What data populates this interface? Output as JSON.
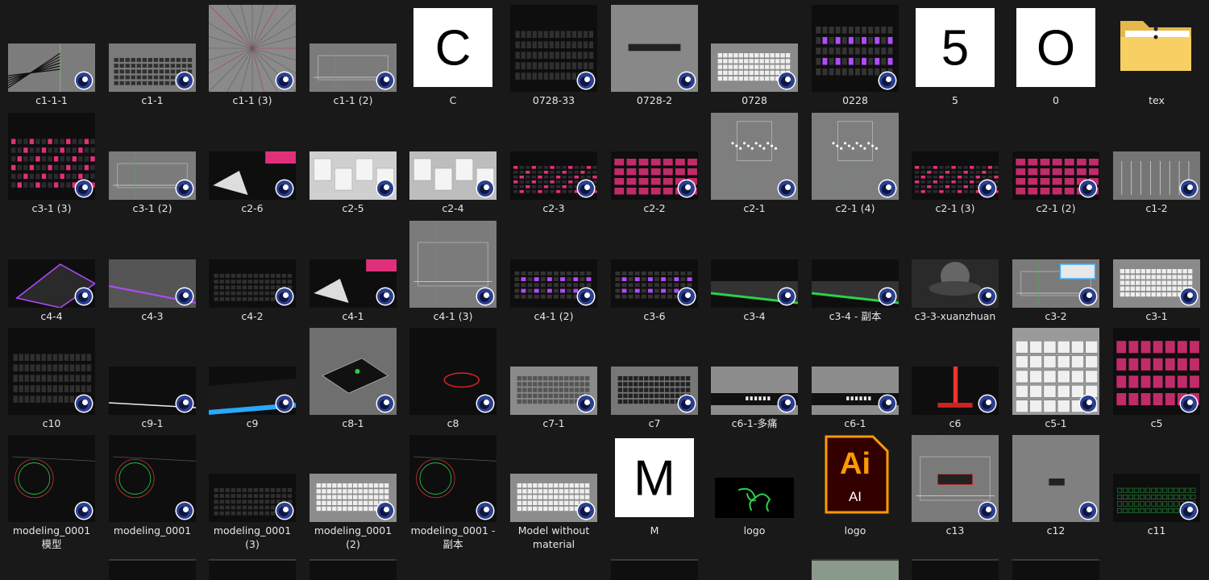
{
  "folder": {
    "items": [
      {
        "label": "c1-1-1",
        "type": "render",
        "style": "grey_lines"
      },
      {
        "label": "c1-1",
        "type": "render",
        "style": "grey"
      },
      {
        "label": "c1-1 (3)",
        "type": "render",
        "style": "rays",
        "tall": true
      },
      {
        "label": "c1-1 (2)",
        "type": "render",
        "style": "grey_wire"
      },
      {
        "label": "C",
        "type": "letter",
        "glyph": "C"
      },
      {
        "label": "0728-33",
        "type": "render",
        "style": "dark_keyboard",
        "tall": true
      },
      {
        "label": "0728-2",
        "type": "render",
        "style": "narrow_grey",
        "tall": true
      },
      {
        "label": "0728",
        "type": "render",
        "style": "white_keyboard"
      },
      {
        "label": "0228",
        "type": "render",
        "style": "purple_dots",
        "tall": true
      },
      {
        "label": "5",
        "type": "letter",
        "glyph": "5"
      },
      {
        "label": "0",
        "type": "letter",
        "glyph": "O"
      },
      {
        "label": "tex",
        "type": "folder"
      },
      {
        "label": "c3-1 (3)",
        "type": "render",
        "style": "dark_pink_grid",
        "tall": true
      },
      {
        "label": "c3-1 (2)",
        "type": "render",
        "style": "grey_wire"
      },
      {
        "label": "c2-6",
        "type": "render",
        "style": "dark_pink_light"
      },
      {
        "label": "c2-5",
        "type": "render",
        "style": "white_room"
      },
      {
        "label": "c2-4",
        "type": "render",
        "style": "white_keys"
      },
      {
        "label": "c2-3",
        "type": "render",
        "style": "dark_pink_grid"
      },
      {
        "label": "c2-2",
        "type": "render",
        "style": "pink_keys"
      },
      {
        "label": "c2-1",
        "type": "render",
        "style": "grey_dots",
        "tall": true
      },
      {
        "label": "c2-1 (4)",
        "type": "render",
        "style": "grey_dots",
        "tall": true
      },
      {
        "label": "c2-1 (3)",
        "type": "render",
        "style": "dark_pattern"
      },
      {
        "label": "c2-1 (2)",
        "type": "render",
        "style": "pink_keys"
      },
      {
        "label": "c1-2",
        "type": "render",
        "style": "grey_pillars"
      },
      {
        "label": "c4-4",
        "type": "render",
        "style": "dark_purple_edge"
      },
      {
        "label": "c4-3",
        "type": "render",
        "style": "grey_purple_strip"
      },
      {
        "label": "c4-2",
        "type": "render",
        "style": "dark_keyboard"
      },
      {
        "label": "c4-1",
        "type": "render",
        "style": "dark_pink_light"
      },
      {
        "label": "c4-1 (3)",
        "type": "render",
        "style": "grey_wire",
        "tall": true
      },
      {
        "label": "c4-1 (2)",
        "type": "render",
        "style": "purple_keyboard"
      },
      {
        "label": "c3-6",
        "type": "render",
        "style": "purple_keyboard"
      },
      {
        "label": "c3-4",
        "type": "render",
        "style": "green_glow"
      },
      {
        "label": "c3-4 - 副本",
        "type": "render",
        "style": "green_glow"
      },
      {
        "label": "c3-3-xuanzhuan",
        "type": "render",
        "style": "knob"
      },
      {
        "label": "c3-2",
        "type": "render",
        "style": "grey_wire_blue"
      },
      {
        "label": "c3-1",
        "type": "render",
        "style": "white_keyboard"
      },
      {
        "label": "c10",
        "type": "render",
        "style": "dark_grey",
        "tall": true
      },
      {
        "label": "c9-1",
        "type": "render",
        "style": "dark_white_strip"
      },
      {
        "label": "c9",
        "type": "render",
        "style": "blue_keyboard"
      },
      {
        "label": "c8-1",
        "type": "render",
        "style": "grey_box",
        "tall": true
      },
      {
        "label": "c8",
        "type": "render",
        "style": "dark_red_ring",
        "tall": true
      },
      {
        "label": "c7-1",
        "type": "render",
        "style": "grey_flat_keyboard"
      },
      {
        "label": "c7",
        "type": "render",
        "style": "grey_side_keyboard"
      },
      {
        "label": "c6-1-多痛",
        "type": "render",
        "style": "white_strip"
      },
      {
        "label": "c6-1",
        "type": "render",
        "style": "white_strip"
      },
      {
        "label": "c6",
        "type": "render",
        "style": "dark_red_beam"
      },
      {
        "label": "c5-1",
        "type": "render",
        "style": "white_keys_grid",
        "tall": true
      },
      {
        "label": "c5",
        "type": "render",
        "style": "pink_keys",
        "tall": true
      },
      {
        "label": "modeling_0001\n模型",
        "type": "render",
        "style": "modeling",
        "tall": true
      },
      {
        "label": "modeling_0001",
        "type": "render",
        "style": "modeling",
        "tall": true
      },
      {
        "label": "modeling_0001\n(3)",
        "type": "render",
        "style": "dark_keyboard"
      },
      {
        "label": "modeling_0001\n(2)",
        "type": "render",
        "style": "grey_white_keys"
      },
      {
        "label": "modeling_0001 -\n副本",
        "type": "render",
        "style": "modeling",
        "tall": true
      },
      {
        "label": "Model without\nmaterial",
        "type": "render",
        "style": "grey_white_keys"
      },
      {
        "label": "M",
        "type": "letter",
        "glyph": "M"
      },
      {
        "label": "logo",
        "type": "razer"
      },
      {
        "label": "logo",
        "type": "ai",
        "glyph_top": "Ai",
        "glyph_bottom": "AI"
      },
      {
        "label": "c13",
        "type": "render",
        "style": "grey_wire_red",
        "tall": true
      },
      {
        "label": "c12",
        "type": "render",
        "style": "grey_plain",
        "tall": true
      },
      {
        "label": "c11",
        "type": "render",
        "style": "green_keyboard"
      }
    ]
  },
  "colors": {
    "background": "#191919",
    "pink": "#e0307a",
    "purple": "#b24bff",
    "green": "#2bd14b",
    "ai_orange": "#ff9a00",
    "ai_bg": "#330000"
  },
  "icons": {
    "badge": "cinema4d-icon",
    "folder": "folder-icon"
  }
}
